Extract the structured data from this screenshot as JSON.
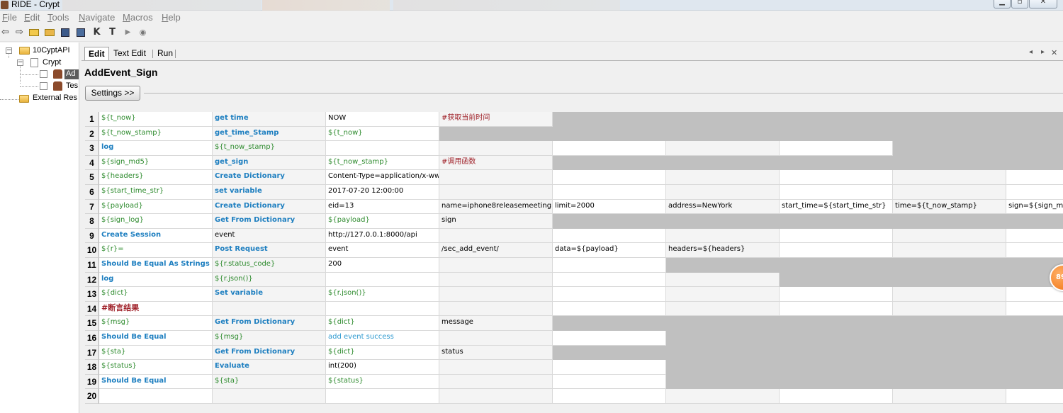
{
  "window": {
    "title": "RIDE - Crypt"
  },
  "menu": [
    "File",
    "Edit",
    "Tools",
    "Navigate",
    "Macros",
    "Help"
  ],
  "toolbar": [
    "back-icon",
    "forward-icon",
    "open-folder-icon",
    "open-directory-icon",
    "save-icon",
    "save-all-icon",
    "keyword-search-icon",
    "test-search-icon",
    "run-icon",
    "stop-icon"
  ],
  "tree": {
    "root": "10CyptAPI",
    "suite": "Crypt",
    "test1": "Ad",
    "test2": "Tes",
    "resources": "External Res"
  },
  "tabs": [
    "Edit",
    "Text Edit",
    "Run"
  ],
  "editor": {
    "title": "AddEvent_Sign",
    "settings_label": "Settings >>"
  },
  "grid": {
    "rows": [
      {
        "n": "1",
        "cells": [
          {
            "t": "${t_now}",
            "s": "var"
          },
          {
            "t": "get time",
            "s": "kw"
          },
          {
            "t": "NOW",
            "s": "arg"
          },
          {
            "t": "#获取当前时间",
            "s": "cmt"
          }
        ],
        "empty": []
      },
      {
        "n": "2",
        "cells": [
          {
            "t": "${t_now_stamp}",
            "s": "var"
          },
          {
            "t": "get_time_Stamp",
            "s": "kw"
          },
          {
            "t": "${t_now}",
            "s": "var"
          }
        ],
        "empty": []
      },
      {
        "n": "3",
        "cells": [
          {
            "t": "log",
            "s": "kw"
          },
          {
            "t": "${t_now_stamp}",
            "s": "var"
          },
          {
            "t": "",
            "s": "arg"
          }
        ],
        "empty": [
          3,
          4,
          5,
          6
        ]
      },
      {
        "n": "4",
        "cells": [
          {
            "t": "${sign_md5}",
            "s": "var"
          },
          {
            "t": "get_sign",
            "s": "kw"
          },
          {
            "t": "${t_now_stamp}",
            "s": "var"
          },
          {
            "t": "#调用函数",
            "s": "cmt"
          }
        ],
        "empty": []
      },
      {
        "n": "5",
        "cells": [
          {
            "t": "${headers}",
            "s": "var"
          },
          {
            "t": "Create Dictionary",
            "s": "kw"
          },
          {
            "t": "Content-Type=application/x-www-",
            "s": "arg"
          }
        ],
        "empty": [
          3,
          4,
          5,
          6,
          7,
          8,
          9
        ]
      },
      {
        "n": "6",
        "cells": [
          {
            "t": "${start_time_str}",
            "s": "var"
          },
          {
            "t": "set variable",
            "s": "kw"
          },
          {
            "t": "2017-07-20 12:00:00",
            "s": "arg"
          }
        ],
        "empty": [
          3,
          4,
          5,
          6,
          7,
          8,
          9
        ]
      },
      {
        "n": "7",
        "cells": [
          {
            "t": "${payload}",
            "s": "var"
          },
          {
            "t": "Create Dictionary",
            "s": "kw"
          },
          {
            "t": "eid=13",
            "s": "arg"
          },
          {
            "t": "name=iphone8releasemeeting",
            "s": "arg"
          },
          {
            "t": "limit=2000",
            "s": "arg"
          },
          {
            "t": "address=NewYork",
            "s": "arg"
          },
          {
            "t": "start_time=${start_time_str}",
            "s": "arg"
          },
          {
            "t": "time=${t_now_stamp}",
            "s": "arg"
          },
          {
            "t": "sign=${sign_md5",
            "s": "arg"
          }
        ],
        "empty": []
      },
      {
        "n": "8",
        "cells": [
          {
            "t": "${sign_log}",
            "s": "var"
          },
          {
            "t": "Get From Dictionary",
            "s": "kw"
          },
          {
            "t": "${payload}",
            "s": "var"
          },
          {
            "t": "sign",
            "s": "arg"
          }
        ],
        "empty": []
      },
      {
        "n": "9",
        "cells": [
          {
            "t": "Create Session",
            "s": "kw"
          },
          {
            "t": "event",
            "s": "arg"
          },
          {
            "t": "http://127.0.0.1:8000/api",
            "s": "arg"
          }
        ],
        "empty": [
          3,
          4,
          5,
          6,
          7,
          8,
          9
        ]
      },
      {
        "n": "10",
        "cells": [
          {
            "t": "${r}=",
            "s": "var"
          },
          {
            "t": "Post Request",
            "s": "kw"
          },
          {
            "t": "event",
            "s": "arg"
          },
          {
            "t": "/sec_add_event/",
            "s": "arg"
          },
          {
            "t": "data=${payload}",
            "s": "arg"
          },
          {
            "t": "headers=${headers}",
            "s": "arg"
          }
        ],
        "empty": [
          6,
          7,
          8,
          9
        ]
      },
      {
        "n": "11",
        "cells": [
          {
            "t": "Should Be Equal As Strings",
            "s": "kw"
          },
          {
            "t": "${r.status_code}",
            "s": "var"
          },
          {
            "t": "200",
            "s": "arg"
          }
        ],
        "empty": [
          3,
          4
        ]
      },
      {
        "n": "12",
        "cells": [
          {
            "t": "log",
            "s": "kw"
          },
          {
            "t": "${r.json()}",
            "s": "var"
          }
        ],
        "empty": [
          2,
          3,
          4,
          5
        ]
      },
      {
        "n": "13",
        "cells": [
          {
            "t": "${dict}",
            "s": "var"
          },
          {
            "t": "Set variable",
            "s": "kw"
          },
          {
            "t": "${r.json()}",
            "s": "var"
          }
        ],
        "empty": [
          3,
          4,
          5,
          6,
          7,
          8,
          9
        ]
      },
      {
        "n": "14",
        "cells": [
          {
            "t": "#断言结果",
            "s": "cmtb"
          }
        ],
        "empty": [
          1,
          2,
          3,
          4,
          5,
          6,
          7,
          8,
          9
        ]
      },
      {
        "n": "15",
        "cells": [
          {
            "t": "${msg}",
            "s": "var"
          },
          {
            "t": "Get From Dictionary",
            "s": "kw"
          },
          {
            "t": "${dict}",
            "s": "var"
          },
          {
            "t": "message",
            "s": "arg"
          }
        ],
        "empty": []
      },
      {
        "n": "16",
        "cells": [
          {
            "t": "Should Be Equal",
            "s": "kw"
          },
          {
            "t": "${msg}",
            "s": "var"
          },
          {
            "t": "add event success",
            "s": "link"
          }
        ],
        "empty": [
          3,
          4
        ]
      },
      {
        "n": "17",
        "cells": [
          {
            "t": "${sta}",
            "s": "var"
          },
          {
            "t": "Get From Dictionary",
            "s": "kw"
          },
          {
            "t": "${dict}",
            "s": "var"
          },
          {
            "t": "status",
            "s": "arg"
          }
        ],
        "empty": []
      },
      {
        "n": "18",
        "cells": [
          {
            "t": "${status}",
            "s": "var"
          },
          {
            "t": "Evaluate",
            "s": "kw"
          },
          {
            "t": "int(200)",
            "s": "arg"
          }
        ],
        "empty": [
          3,
          4
        ]
      },
      {
        "n": "19",
        "cells": [
          {
            "t": "Should Be Equal",
            "s": "kw"
          },
          {
            "t": "${sta}",
            "s": "var"
          },
          {
            "t": "${status}",
            "s": "var"
          }
        ],
        "empty": [
          3,
          4
        ]
      },
      {
        "n": "20",
        "cells": [],
        "empty": [
          0,
          1,
          2,
          3,
          4,
          5,
          6,
          7,
          8,
          9
        ]
      }
    ]
  },
  "badge": "89"
}
